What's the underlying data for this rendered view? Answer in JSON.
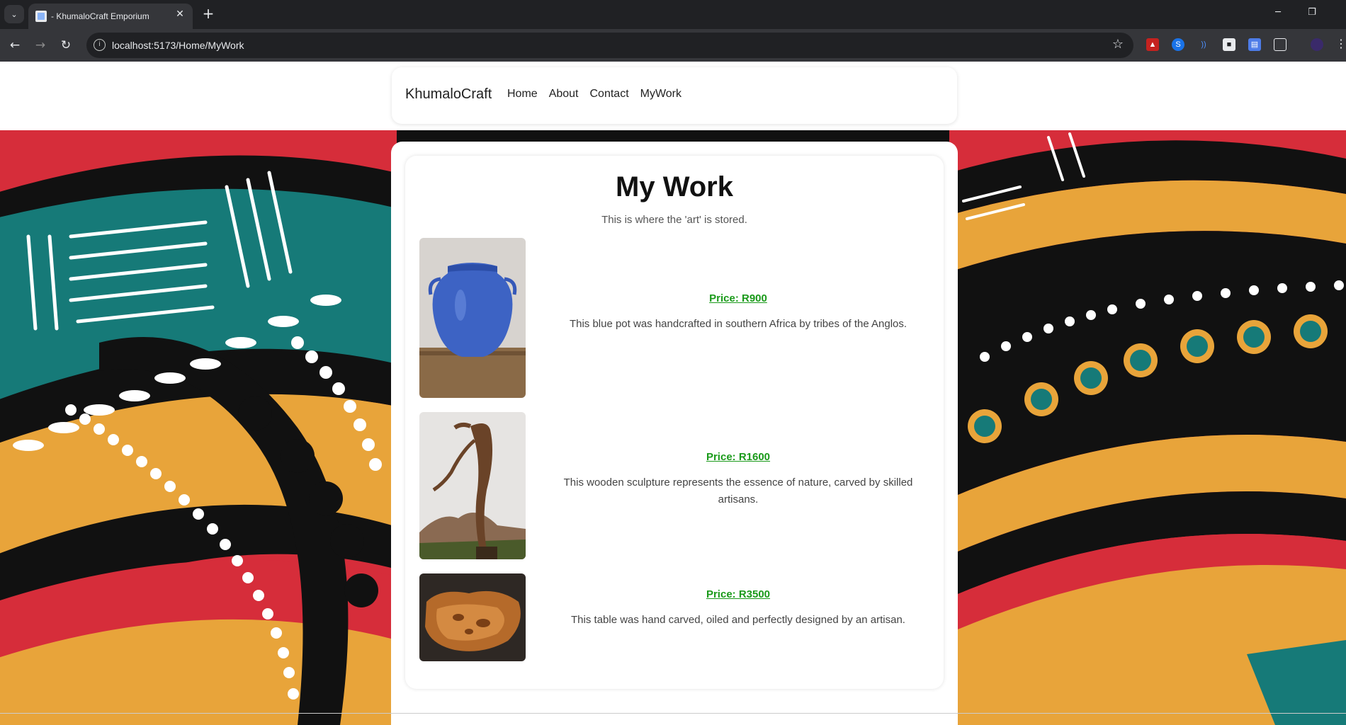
{
  "browser": {
    "tab_title": "- KhumaloCraft Emporium",
    "url": "localhost:5173/Home/MyWork"
  },
  "nav": {
    "brand": "KhumaloCraft",
    "links": [
      "Home",
      "About",
      "Contact",
      "MyWork"
    ]
  },
  "main": {
    "title": "My Work",
    "subtitle": "This is where the 'art' is stored.",
    "items": [
      {
        "price": "Price: R900",
        "description": "This blue pot was handcrafted in southern Africa by tribes of the Anglos."
      },
      {
        "price": "Price: R1600",
        "description": "This wooden sculpture represents the essence of nature, carved by skilled artisans."
      },
      {
        "price": "Price: R3500",
        "description": "This table was hand carved, oiled and perfectly designed by an artisan."
      }
    ]
  },
  "colors": {
    "price_link": "#1a9a1a",
    "pattern_red": "#d62d3a",
    "pattern_teal": "#167a78",
    "pattern_orange": "#e8a43a"
  }
}
